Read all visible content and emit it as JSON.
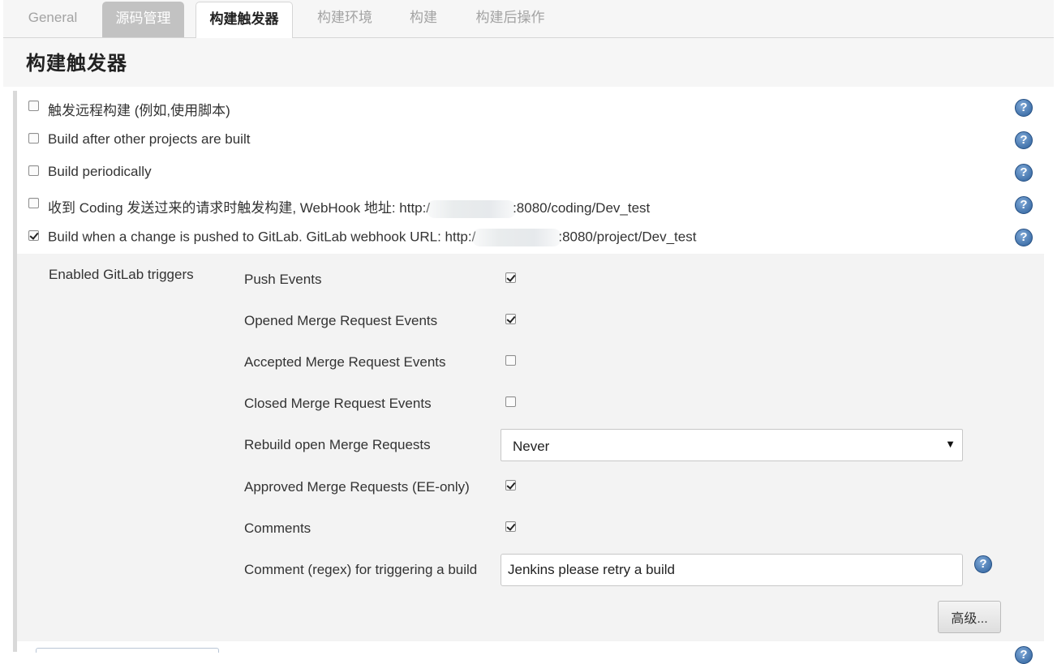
{
  "tabs": [
    {
      "label": "General",
      "state": "normal"
    },
    {
      "label": "源码管理",
      "state": "visited"
    },
    {
      "label": "构建触发器",
      "state": "active"
    },
    {
      "label": "构建环境",
      "state": "normal"
    },
    {
      "label": "构建",
      "state": "normal"
    },
    {
      "label": "构建后操作",
      "state": "normal"
    }
  ],
  "section": {
    "title": "构建触发器"
  },
  "triggers": [
    {
      "label": "触发远程构建 (例如,使用脚本)",
      "checked": false
    },
    {
      "label": "Build after other projects are built",
      "checked": false
    },
    {
      "label": "Build periodically",
      "checked": false
    },
    {
      "label_prefix": "收到 Coding 发送过来的请求时触发构建, WebHook 地址: http:/",
      "label_suffix": ":8080/coding/Dev_test",
      "checked": false
    },
    {
      "label_prefix": "Build when a change is pushed to GitLab. GitLab webhook URL: http:/",
      "label_suffix": ":8080/project/Dev_test",
      "checked": true
    }
  ],
  "gitlab": {
    "section_label": "Enabled GitLab triggers",
    "options": [
      {
        "label": "Push Events",
        "checked": true
      },
      {
        "label": "Opened Merge Request Events",
        "checked": true
      },
      {
        "label": "Accepted Merge Request Events",
        "checked": false
      },
      {
        "label": "Closed Merge Request Events",
        "checked": false
      }
    ],
    "rebuild_label": "Rebuild open Merge Requests",
    "rebuild_value": "Never",
    "approved_label": "Approved Merge Requests (EE-only)",
    "approved_checked": true,
    "comments_label": "Comments",
    "comments_checked": true,
    "comment_regex_label": "Comment (regex) for triggering a build",
    "comment_regex_value": "Jenkins please retry a build",
    "advanced_button": "高级..."
  },
  "help_icon": "question-mark-icon",
  "colors": {
    "tab_visited_bg": "#c2c2c2",
    "help_icon_blue": "#2c5f9a",
    "panel_bg": "#f3f3f3"
  }
}
